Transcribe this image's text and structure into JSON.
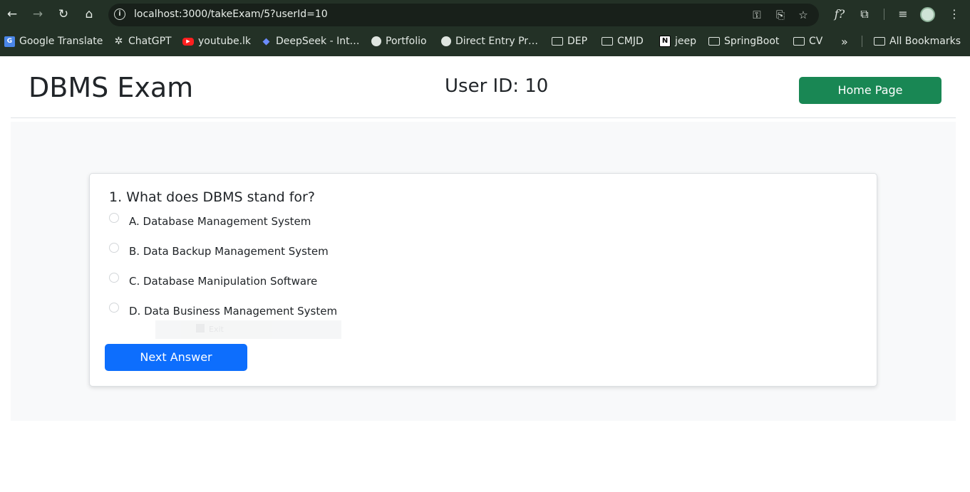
{
  "browser": {
    "url": "localhost:3000/takeExam/5?userId=10",
    "bookmarks": [
      {
        "label": "Google Translate",
        "icon": "google-translate-icon"
      },
      {
        "label": "ChatGPT",
        "icon": "chatgpt-icon"
      },
      {
        "label": "youtube.lk",
        "icon": "youtube-icon"
      },
      {
        "label": "DeepSeek - Int…",
        "icon": "deepseek-icon"
      },
      {
        "label": "Portfolio",
        "icon": "globe-icon"
      },
      {
        "label": "Direct Entry Pr…",
        "icon": "globe-icon"
      },
      {
        "label": "DEP",
        "icon": "folder-icon"
      },
      {
        "label": "CMJD",
        "icon": "folder-icon"
      },
      {
        "label": "jeep",
        "icon": "notion-icon"
      },
      {
        "label": "SpringBoot",
        "icon": "folder-icon"
      },
      {
        "label": "CV",
        "icon": "folder-icon"
      }
    ],
    "overflow_label": "»",
    "all_bookmarks_label": "All Bookmarks"
  },
  "header": {
    "title": "DBMS Exam",
    "user_id": "User ID: 10",
    "home_button": "Home Page"
  },
  "exam": {
    "question": "1. What does DBMS stand for?",
    "options": [
      "A. Database Management System",
      "B. Data Backup Management System",
      "C. Database Manipulation Software",
      "D. Data Business Management System"
    ],
    "ghost_text": "Exit",
    "next_button": "Next Answer"
  },
  "colors": {
    "chrome": "#233126",
    "home_button": "#198754",
    "next_button": "#0d6efd",
    "main_bg": "#f8f9fa"
  }
}
